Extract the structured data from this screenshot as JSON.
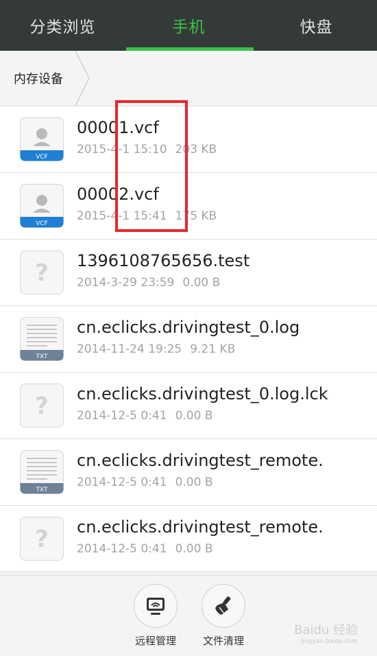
{
  "tabs": [
    {
      "label": "分类浏览",
      "active": false
    },
    {
      "label": "手机",
      "active": true
    },
    {
      "label": "快盘",
      "active": false
    }
  ],
  "breadcrumb": {
    "label": "内存设备"
  },
  "files": [
    {
      "name": "00001.vcf",
      "date": "2015-4-1 15:10",
      "size": "203 KB",
      "icon": "vcf-contact-icon",
      "badge": "VCF"
    },
    {
      "name": "00002.vcf",
      "date": "2015-4-1 15:41",
      "size": "175 KB",
      "icon": "vcf-contact-icon",
      "badge": "VCF"
    },
    {
      "name": "1396108765656.test",
      "date": "2014-3-29 23:59",
      "size": "0.00 B",
      "icon": "unknown-file-icon",
      "badge": ""
    },
    {
      "name": "cn.eclicks.drivingtest_0.log",
      "date": "2014-11-24 19:25",
      "size": "9.21 KB",
      "icon": "txt-file-icon",
      "badge": "TXT"
    },
    {
      "name": "cn.eclicks.drivingtest_0.log.lck",
      "date": "2014-12-5 0:41",
      "size": "0.00 B",
      "icon": "unknown-file-icon",
      "badge": ""
    },
    {
      "name": "cn.eclicks.drivingtest_remote.",
      "date": "2014-12-5 0:41",
      "size": "0.00 B",
      "icon": "txt-file-icon",
      "badge": "TXT"
    },
    {
      "name": "cn.eclicks.drivingtest_remote.",
      "date": "2014-12-5 0:41",
      "size": "0.00 B",
      "icon": "unknown-file-icon",
      "badge": ""
    }
  ],
  "actions": [
    {
      "label": "远程管理",
      "icon": "remote-monitor-icon"
    },
    {
      "label": "文件清理",
      "icon": "broom-clean-icon"
    }
  ],
  "watermark": {
    "text": "Baidu 经验",
    "sub": "jingyan.baidu.com"
  },
  "colors": {
    "accent": "#3bc248",
    "topbar": "#333a37",
    "highlight": "#e8262a",
    "vcf_badge": "#1f7fd4",
    "txt_badge": "#6f8196"
  }
}
